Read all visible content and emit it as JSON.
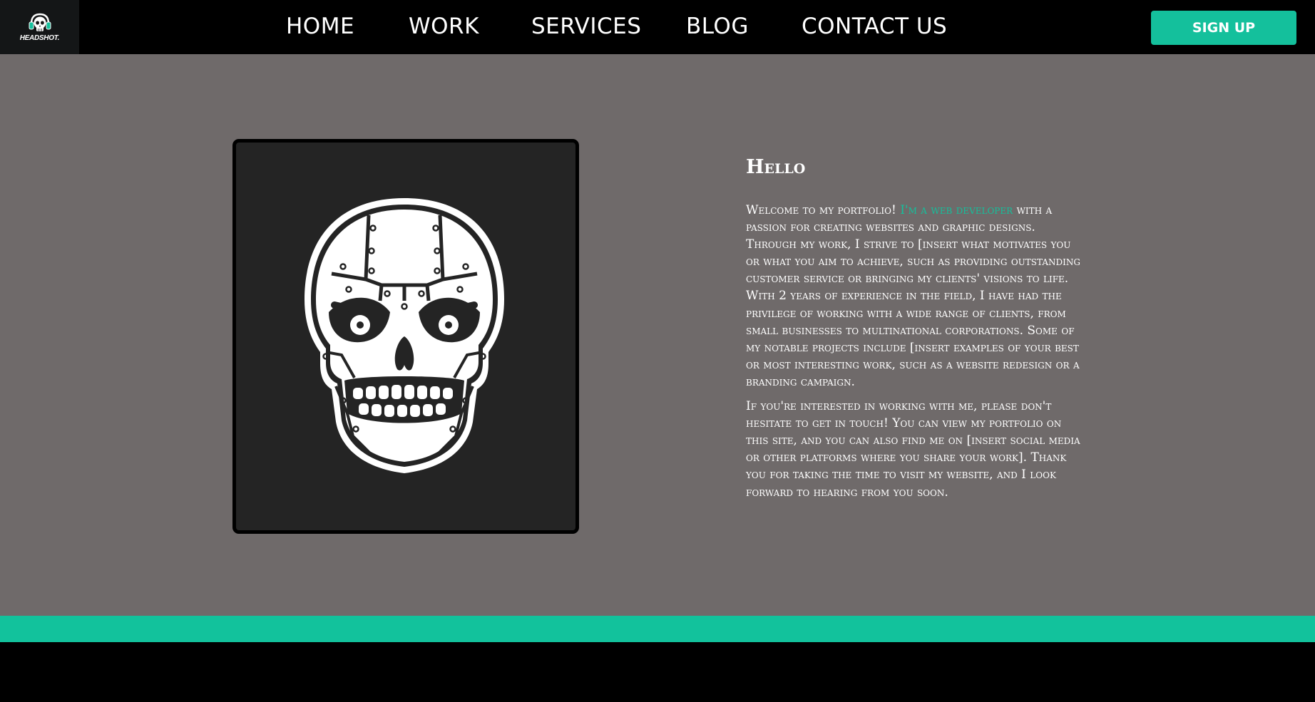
{
  "logo": {
    "text": "HEADSHOT.",
    "icon": "skull-headphones-icon"
  },
  "nav": {
    "items": [
      {
        "label": "HOME"
      },
      {
        "label": "WORK"
      },
      {
        "label": "SERVICES"
      },
      {
        "label": "BLOG"
      },
      {
        "label": "CONTACT US"
      }
    ],
    "signup_label": "SIGN UP"
  },
  "hero": {
    "image_icon": "robot-skull-icon"
  },
  "content": {
    "heading": "Hello",
    "para1_start": "Welcome to my portfolio! ",
    "para1_highlight": "I'm a web developer",
    "para1_end": " with a passion for creating websites and graphic designs. Through my work, I strive to [insert what motivates you or what you aim to achieve, such as providing outstanding customer service or bringing my clients' visions to life. With 2 years of experience in the field, I have had the privilege of working with a wide range of clients, from small businesses to multinational corporations. Some of my notable projects include [insert examples of your best or most interesting work, such as a website redesign or a branding campaign.",
    "para2": "If you're interested in working with me, please don't hesitate to get in touch! You can view my portfolio on this site, and you can also find me on [insert social media or other platforms where you share your work]. Thank you for taking the time to visit my website, and I look forward to hearing from you soon."
  },
  "colors": {
    "accent": "#14c09c",
    "background": "#6f6a6a",
    "nav_bg": "#000000",
    "frame_bg": "#242424"
  }
}
